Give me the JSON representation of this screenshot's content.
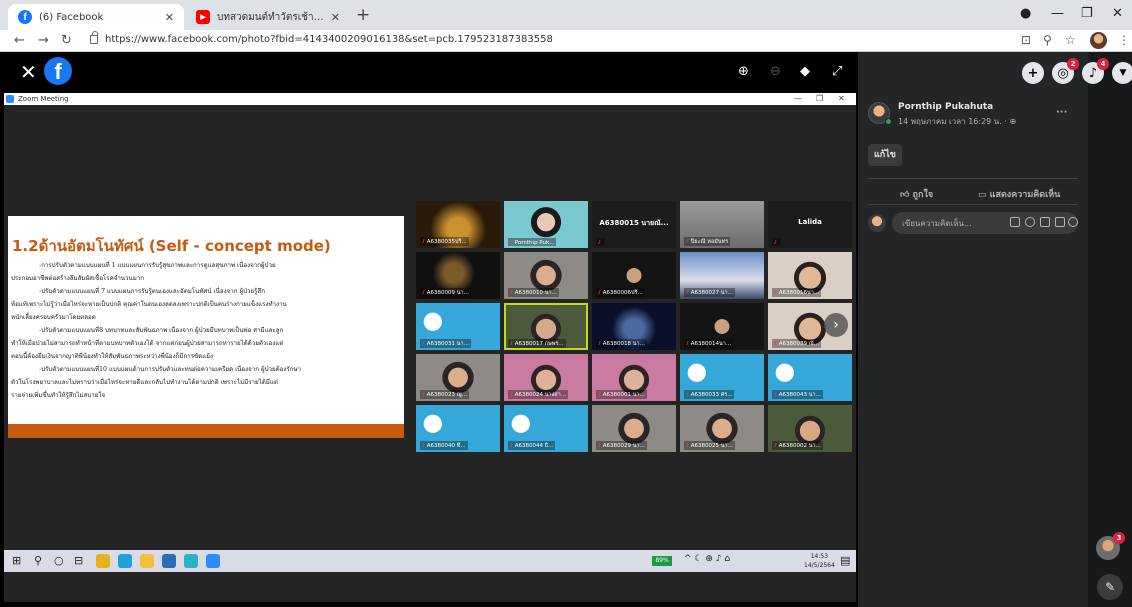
{
  "browser": {
    "tabs": [
      {
        "title": "(6) Facebook",
        "favicon": "facebook-icon",
        "active": true
      },
      {
        "title": "บทสวดมนต์ทำวัตรเช้า วัดหนองป่าพง",
        "favicon": "youtube-icon",
        "active": false
      }
    ],
    "url": "https://www.facebook.com/photo?fbid=4143400209016138&set=pcb.179523187383558"
  },
  "zoom": {
    "window_title": "Zoom Meeting",
    "slide": {
      "title": "1.2ด้านอัตมโนทัศน์ (Self - concept mode)",
      "paragraphs": [
        "-การปรับตัวตามแบบแผนที่ 1 แบบแผนการรับรู้สุขภาพและการดูแลสุขภาพ เนื่องจากผู้ป่วย",
        "ประกอบอาชีพต่อสร้างลึมสัมผัสเชื้อโรคจำนวนมาก",
        "-ปรับตัวตามแบบแผนที่ 7 แบบแผนการรับรู้ตนเองและอัตมโนทัศน์ เนื่องจาก ผู้ป่วยรู้สึก",
        "ท้อแท้เพราะไม่รู้ว่าเมื่อไหร่จะหายเป็นปกติ คุณค่าในตนเองลดลงเพราะปกติเป็นคนร่างกายแข็งแรงทำงาน",
        "หนักเลี้ยงครอบครัวมาโดยตลอด",
        "-ปรับตัวตามแบบแผนที่8 บทบาทและสัมพันธภาพ เนื่องจาก ผู้ป่วยมีบทบาทเป็นพ่อ สามีและลูก",
        "ทำให้เมื่อป่วยไม่สามารถทำหน้าที่ตามบทบาทตัวเองได้ จากแต่ก่อนผู้ป่วยสามารถหารายได้ด้วยตัวเองแต่",
        "ตอนนี้ต้องยืมเงินจากญาติพี่น้องทำให้สัมพันธภาพระหว่างพี่น้องก็มีการขัดแย้ง",
        "-ปรับตัวตามแบบแผนที่10 แบบแผนด้านการปรับตัวและทนต่อความเครียด เนื่องจาก ผู้ป่วยต้องรักษา",
        "ตัวในโรงพยาบาลและไม่ทราบว่าเมื่อไหร่จะหายดีและกลับไปทำงานได้ตามปกติ เพราะไม่มีรายได้มีแต่",
        "รายจ่ายเพิ่มขึ้นทำให้รู้สึกไม่สบายใจ"
      ]
    },
    "participants": [
      {
        "name": "A6380035ปริ...",
        "tile": "dark-gold"
      },
      {
        "name": "Pornthip Puk...",
        "tile": "teal"
      },
      {
        "name": "A6380015 นายณั...",
        "tile": "name-only"
      },
      {
        "name": "ปิยะณี หอมันทร",
        "tile": "gray"
      },
      {
        "name": "Lalida",
        "tile": "name-only"
      },
      {
        "name": "A6380009 นา...",
        "tile": "dark"
      },
      {
        "name": "A6380010 นา...",
        "tile": "face"
      },
      {
        "name": "A6380006ปริ...",
        "tile": "dark-face"
      },
      {
        "name": "A6380027 นา...",
        "tile": "sky"
      },
      {
        "name": "A6380016นา...",
        "tile": "face-light"
      },
      {
        "name": "A6380031 นา...",
        "tile": "cartoon"
      },
      {
        "name": "A6380017 กษพร...",
        "tile": "face-green"
      },
      {
        "name": "A6380018 นา...",
        "tile": "night"
      },
      {
        "name": "A6380014นา...",
        "tile": "dark-face"
      },
      {
        "name": "A6380039 ณั...",
        "tile": "face-light"
      },
      {
        "name": "A6380023 ณู...",
        "tile": "face"
      },
      {
        "name": "A6380024 นางสา...",
        "tile": "face-pink"
      },
      {
        "name": "A6380001 นา...",
        "tile": "face-pink"
      },
      {
        "name": "A6380033 ศร...",
        "tile": "cartoon"
      },
      {
        "name": "A6380043 นา...",
        "tile": "cartoon"
      },
      {
        "name": "A6380040 ที...",
        "tile": "cartoon"
      },
      {
        "name": "A6380044 ธิ...",
        "tile": "cartoon"
      },
      {
        "name": "A6380029 นา...",
        "tile": "face"
      },
      {
        "name": "A6380025 นา...",
        "tile": "face"
      },
      {
        "name": "A6380002 นา...",
        "tile": "face-green"
      }
    ],
    "taskbar": {
      "battery": "89%",
      "time": "14:53",
      "date": "14/5/2564"
    }
  },
  "panel": {
    "badges": {
      "messenger": "2",
      "notifications": "4",
      "chat": "3"
    },
    "author": "Pornthip Pukahuta",
    "post_time": "14 พฤษภาคม เวลา 16:29 น. · ⊕",
    "edit_label": "แก้ไข",
    "like_label": "ถูกใจ",
    "comment_label": "แสดงความคิดเห็น",
    "comment_placeholder": "เขียนความคิดเห็น..."
  },
  "colors": {
    "facebook_blue": "#1877f2",
    "panel_bg": "#242526",
    "slide_accent": "#c55a11"
  }
}
